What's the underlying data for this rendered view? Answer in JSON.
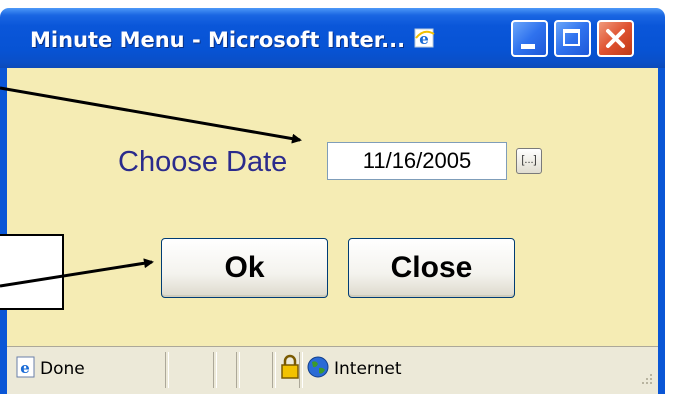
{
  "window": {
    "title": "Minute Menu - Microsoft Inter...",
    "controls": [
      "minimize",
      "maximize",
      "close"
    ]
  },
  "form": {
    "date_label": "Choose Date",
    "date_value": "11/16/2005",
    "picker_label": "[...]",
    "ok_label": "Ok",
    "close_label": "Close"
  },
  "statusbar": {
    "left_text": "Done",
    "zone_text": "Internet",
    "icons": [
      "ie-page-icon",
      "lock-icon",
      "globe-icon"
    ]
  },
  "colors": {
    "body_bg": "#f5ecb4",
    "label_color": "#2b2b8c",
    "title_blue": "#0a56d6",
    "close_red": "#d6462a"
  }
}
